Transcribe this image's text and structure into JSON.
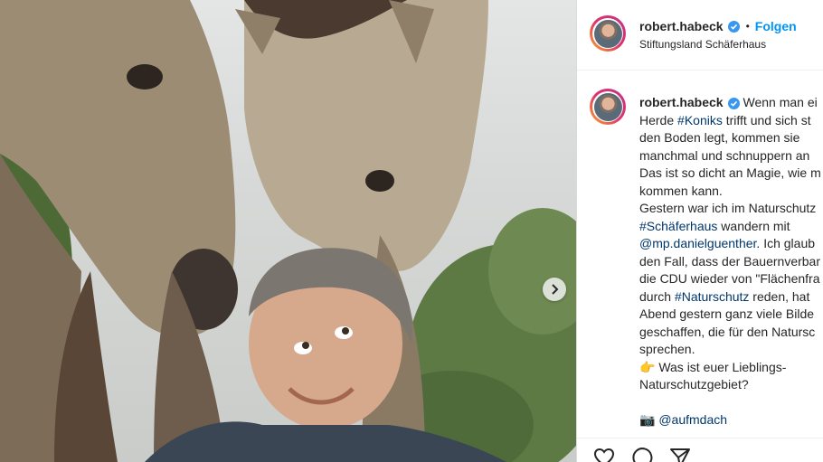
{
  "post": {
    "username": "robert.habeck",
    "follow_label": "Folgen",
    "separator": "•",
    "location": "Stiftungsland Schäferhaus"
  },
  "caption": {
    "username": "robert.habeck",
    "line1": "Wenn man ei",
    "line2_pre": "Herde ",
    "line2_tag": "#Koniks",
    "line2_post": " trifft und sich st",
    "line3": "den Boden legt, kommen sie",
    "line4": "manchmal und schnuppern an",
    "line5": "Das ist so dicht an Magie, wie m",
    "line6": "kommen kann.",
    "line7": "Gestern war ich im Naturschutz",
    "line8_tag": "#Schäferhaus",
    "line8_post": " wandern mit",
    "line9_mention": "@mp.danielguenther",
    "line9_post": ". Ich glaub",
    "line10": "den Fall, dass der Bauernverbar",
    "line11": "die CDU wieder von \"Flächenfra",
    "line12_pre": "durch ",
    "line12_tag": "#Naturschutz",
    "line12_post": " reden, hat",
    "line13": "Abend gestern ganz viele Bilde",
    "line14": "geschaffen, die für den Natursc",
    "line15": "sprechen.",
    "line16_emoji": "👉",
    "line16": " Was ist euer Lieblings-",
    "line17": "Naturschutzgebiet?",
    "line18_emoji": "📷",
    "line18_mention": "@aufmdach"
  },
  "icons": {
    "verified": "verified-badge-icon",
    "carousel_next": "chevron-right-icon",
    "like": "heart-icon",
    "comment": "comment-icon",
    "share": "paper-plane-icon"
  },
  "colors": {
    "accent": "#0095f6",
    "verified": "#3897f0",
    "hashtag": "#00376b",
    "text": "#262626"
  }
}
